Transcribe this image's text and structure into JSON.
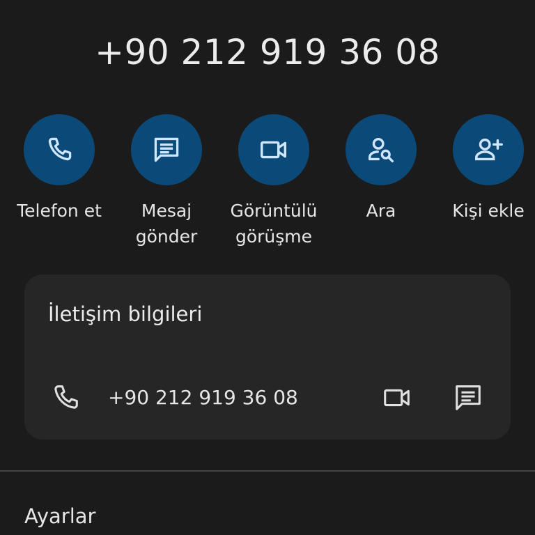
{
  "header": {
    "phone_number": "+90 212 919 36 08"
  },
  "actions": [
    {
      "label": "Telefon et",
      "icon": "phone-icon"
    },
    {
      "label": "Mesaj\ngönder",
      "icon": "message-icon"
    },
    {
      "label": "Görüntülü\ngörüşme",
      "icon": "video-call-icon"
    },
    {
      "label": "Ara",
      "icon": "person-search-icon"
    },
    {
      "label": "Kişi ekle",
      "icon": "add-person-icon"
    }
  ],
  "contact_info": {
    "title": "İletişim bilgileri",
    "phone_number": "+90 212 919 36 08",
    "icons": [
      "phone-icon",
      "video-call-icon",
      "message-icon"
    ]
  },
  "settings": {
    "label": "Ayarlar"
  },
  "colors": {
    "background": "#1b1b1b",
    "action_circle": "#0b4a78",
    "action_icon": "#cfe6ff",
    "card_background": "#262626",
    "divider": "#444444",
    "text": "#e6e6e6"
  }
}
